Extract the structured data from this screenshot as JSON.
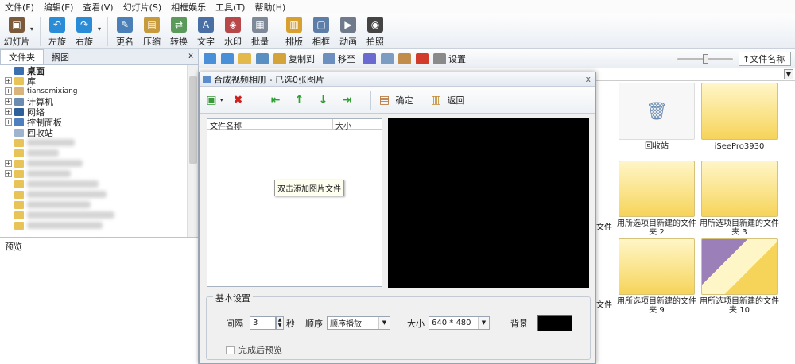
{
  "menu": [
    "文件(F)",
    "编辑(E)",
    "查看(V)",
    "幻灯片(S)",
    "相框娱乐",
    "工具(T)",
    "帮助(H)"
  ],
  "toolbar": {
    "slideshow": "幻灯片",
    "rotate_left": "左旋",
    "rotate_right": "右旋",
    "rename": "更名",
    "compress": "压缩",
    "convert": "转换",
    "text": "文字",
    "watermark": "水印",
    "batch": "批量",
    "layout": "排版",
    "frame": "相框",
    "animation": "动画",
    "capture": "拍照"
  },
  "left_panel": {
    "tab_folders": "文件夹",
    "tab_thumbs": "搁图",
    "close": "x",
    "tree": [
      {
        "label": "桌面",
        "bold": true
      },
      {
        "label": "库"
      },
      {
        "label": "tiansemixiang"
      },
      {
        "label": "计算机"
      },
      {
        "label": "网络"
      },
      {
        "label": "控制面板"
      },
      {
        "label": "回收站"
      }
    ],
    "preview_label": "预览"
  },
  "right_toolbar": {
    "copy_to": "复制到",
    "move_to": "移至",
    "settings": "设置",
    "sort": "↑文件名称"
  },
  "thumbnails": [
    {
      "caption": "回收站",
      "type": "recycle"
    },
    {
      "caption": "iSeePro3930",
      "type": "folder"
    },
    {
      "caption": "用所选项目新建的文件夹 2",
      "type": "folder"
    },
    {
      "caption": "用所选项目新建的文件夹 3",
      "type": "folder"
    },
    {
      "caption": "用所选项目新建的文件夹 9",
      "type": "folder"
    },
    {
      "caption": "用所选项目新建的文件夹 10",
      "type": "folder"
    },
    {
      "caption_left_edge": "文件"
    }
  ],
  "dialog": {
    "title": "合成视频相册 - 已选0张图片",
    "close": "x",
    "confirm": "确定",
    "back": "返回",
    "col_name": "文件名称",
    "col_size": "大小",
    "hint": "双击添加图片文件",
    "basic_settings": "基本设置",
    "interval_label": "间隔",
    "interval_value": "3",
    "seconds": "秒",
    "order_label": "顺序",
    "order_value": "顺序播放",
    "size_label": "大小",
    "size_value": "640 * 480",
    "bg_label": "背景",
    "bg_color": "#000000",
    "preview_after": "完成后预览"
  }
}
